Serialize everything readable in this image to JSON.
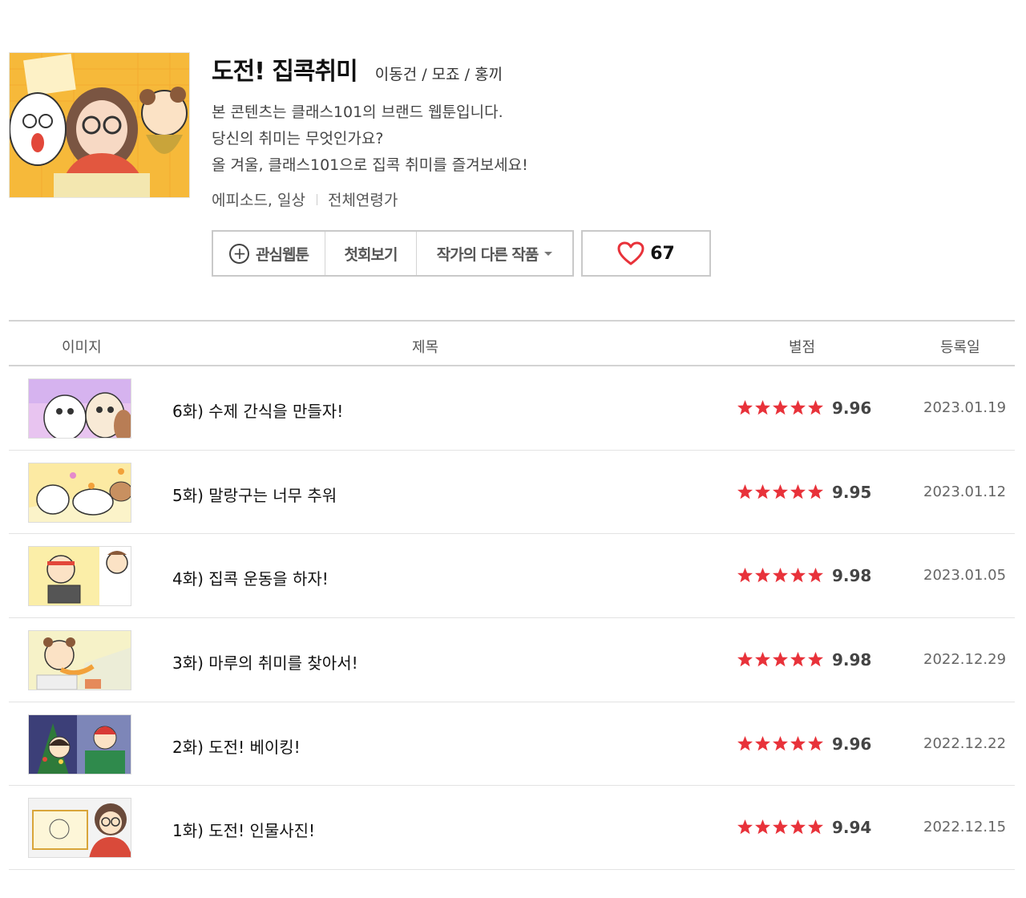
{
  "webtoon": {
    "title": "도전! 집콕취미",
    "authors": "이동건 / 모죠 / 홍끼",
    "description": [
      "본 콘텐츠는 클래스101의 브랜드 웹툰입니다.",
      "당신의 취미는 무엇인가요?",
      "올 겨울, 클래스101으로 집콕 취미를 즐겨보세요!"
    ],
    "genre": "에피소드, 일상",
    "age": "전체연령가"
  },
  "actions": {
    "favorite_label": "관심웹툰",
    "first_ep_label": "첫회보기",
    "other_works_label": "작가의 다른 작품",
    "like_count": "67"
  },
  "colors": {
    "star": "#e8323a",
    "heart": "#e8323a"
  },
  "table": {
    "headers": {
      "image": "이미지",
      "title": "제목",
      "rating": "별점",
      "date": "등록일"
    },
    "rows": [
      {
        "title": "6화) 수제 간식을 만들자!",
        "rating": "9.96",
        "date": "2023.01.19",
        "stars": 5
      },
      {
        "title": "5화) 말랑구는 너무 추워",
        "rating": "9.95",
        "date": "2023.01.12",
        "stars": 5
      },
      {
        "title": "4화) 집콕 운동을 하자!",
        "rating": "9.98",
        "date": "2023.01.05",
        "stars": 5
      },
      {
        "title": "3화) 마루의 취미를 찾아서!",
        "rating": "9.98",
        "date": "2022.12.29",
        "stars": 5
      },
      {
        "title": "2화) 도전! 베이킹!",
        "rating": "9.96",
        "date": "2022.12.22",
        "stars": 5
      },
      {
        "title": "1화) 도전! 인물사진!",
        "rating": "9.94",
        "date": "2022.12.15",
        "stars": 5
      }
    ]
  }
}
